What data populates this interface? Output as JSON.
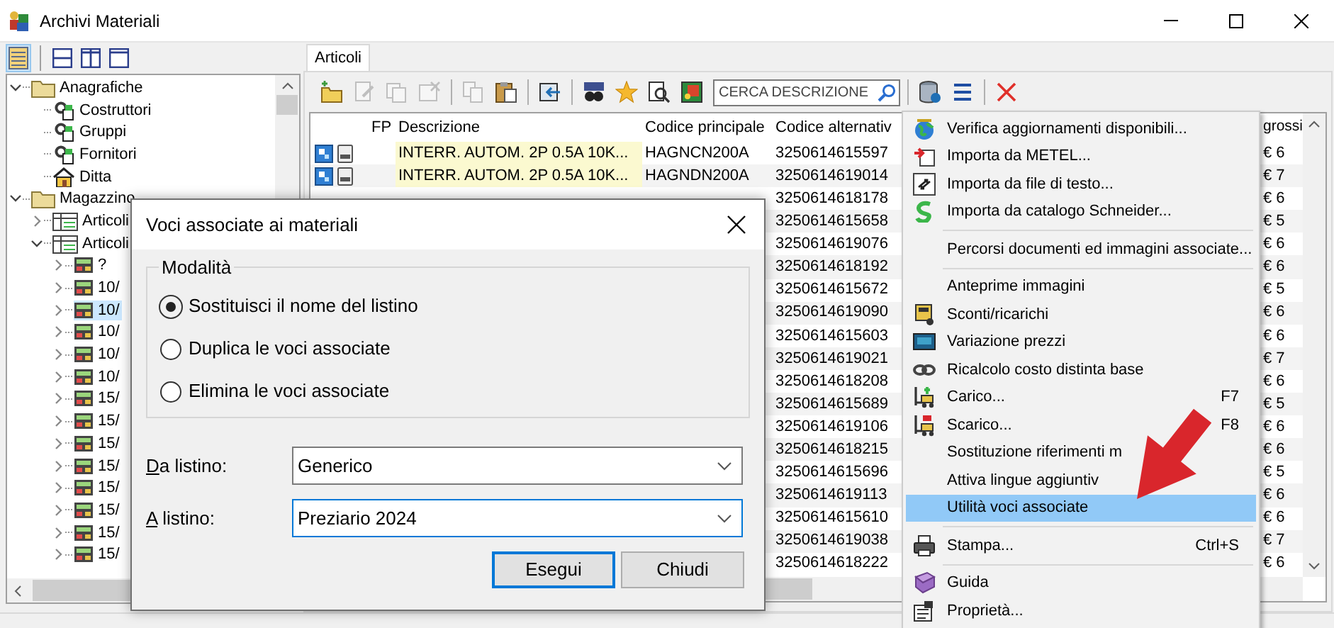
{
  "window": {
    "title": "Archivi Materiali"
  },
  "left_toolbar": [
    {
      "selected": true
    },
    {
      "selected": false
    },
    {
      "selected": false
    },
    {
      "selected": false
    }
  ],
  "tree": [
    {
      "label": "Anagrafiche",
      "kind": "folder",
      "expanded": true,
      "selected": false,
      "children": [
        {
          "label": "Costruttori",
          "kind": "entity",
          "selected": false
        },
        {
          "label": "Gruppi",
          "kind": "entity",
          "selected": false
        },
        {
          "label": "Fornitori",
          "kind": "entity",
          "selected": false
        },
        {
          "label": "Ditta",
          "kind": "company",
          "selected": false
        }
      ]
    },
    {
      "label": "Magazzino",
      "kind": "folder",
      "expanded": true,
      "selected": false,
      "children": [
        {
          "label": "Articoli",
          "kind": "catalog",
          "expanded": false,
          "selected": false
        },
        {
          "label": "Articoli",
          "kind": "catalog",
          "expanded": true,
          "selected": false,
          "children": [
            {
              "label": "?",
              "kind": "record",
              "expanded": false,
              "selected": false
            },
            {
              "label": "10/",
              "kind": "record",
              "expanded": false,
              "selected": false
            },
            {
              "label": "10/",
              "kind": "record",
              "expanded": false,
              "selected": true
            },
            {
              "label": "10/",
              "kind": "record",
              "expanded": false,
              "selected": false
            },
            {
              "label": "10/",
              "kind": "record",
              "expanded": false,
              "selected": false
            },
            {
              "label": "10/",
              "kind": "record",
              "expanded": false,
              "selected": false
            },
            {
              "label": "15/",
              "kind": "record",
              "expanded": false,
              "selected": false
            },
            {
              "label": "15/",
              "kind": "record",
              "expanded": false,
              "selected": false
            },
            {
              "label": "15/",
              "kind": "record",
              "expanded": false,
              "selected": false
            },
            {
              "label": "15/",
              "kind": "record",
              "expanded": false,
              "selected": false
            },
            {
              "label": "15/",
              "kind": "record",
              "expanded": false,
              "selected": false
            },
            {
              "label": "15/",
              "kind": "record",
              "expanded": false,
              "selected": false
            },
            {
              "label": "15/",
              "kind": "record",
              "expanded": false,
              "selected": false
            },
            {
              "label": "15/",
              "kind": "record",
              "expanded": false,
              "selected": false
            }
          ]
        }
      ]
    }
  ],
  "tabs": [
    {
      "label": "Articoli",
      "selected": true
    }
  ],
  "toolbar": [
    {
      "kind": "button",
      "disabled": false
    },
    {
      "kind": "button",
      "disabled": true
    },
    {
      "kind": "button",
      "disabled": true
    },
    {
      "kind": "button",
      "disabled": true
    },
    {
      "kind": "separator"
    },
    {
      "kind": "button",
      "disabled": true
    },
    {
      "kind": "button",
      "disabled": false
    },
    {
      "kind": "separator"
    },
    {
      "kind": "button",
      "disabled": false
    },
    {
      "kind": "separator"
    },
    {
      "kind": "button",
      "disabled": false
    },
    {
      "kind": "button",
      "disabled": false
    },
    {
      "kind": "button",
      "disabled": false
    },
    {
      "kind": "button",
      "disabled": false
    },
    {
      "kind": "search",
      "placeholder": "CERCA DESCRIZIONE"
    },
    {
      "kind": "separator"
    },
    {
      "kind": "button",
      "disabled": false
    },
    {
      "kind": "button",
      "disabled": false
    },
    {
      "kind": "separator"
    },
    {
      "kind": "button",
      "disabled": false
    }
  ],
  "table": {
    "columns": [
      "FP",
      "Descrizione",
      "Codice principale",
      "Codice alternativ",
      "grossi"
    ],
    "rows": [
      {
        "description": "INTERR. AUTOM. 2P 0.5A 10K...",
        "code": "HAGNCN200A",
        "alt_code": "3250614615597",
        "price": "€ 6"
      },
      {
        "description": "INTERR. AUTOM. 2P 0.5A 10K...",
        "code": "HAGNDN200A",
        "alt_code": "3250614619014",
        "price": "€ 7"
      },
      {
        "alt_code": "3250614618178",
        "price": "€ 6"
      },
      {
        "alt_code": "3250614615658",
        "price": "€ 5"
      },
      {
        "alt_code": "3250614619076",
        "price": "€ 6"
      },
      {
        "alt_code": "3250614618192",
        "price": "€ 6"
      },
      {
        "alt_code": "3250614615672",
        "price": "€ 5"
      },
      {
        "alt_code": "3250614619090",
        "price": "€ 6"
      },
      {
        "alt_code": "3250614615603",
        "price": "€ 6"
      },
      {
        "alt_code": "3250614619021",
        "price": "€ 7"
      },
      {
        "alt_code": "3250614618208",
        "price": "€ 6"
      },
      {
        "alt_code": "3250614615689",
        "price": "€ 5"
      },
      {
        "alt_code": "3250614619106",
        "price": "€ 6"
      },
      {
        "alt_code": "3250614618215",
        "price": "€ 6"
      },
      {
        "alt_code": "3250614615696",
        "price": "€ 5"
      },
      {
        "alt_code": "3250614619113",
        "price": "€ 6"
      },
      {
        "alt_code": "3250614615610",
        "price": "€ 6"
      },
      {
        "alt_code": "3250614619038",
        "price": "€ 7"
      },
      {
        "alt_code": "3250614618222",
        "price": "€ 6"
      }
    ]
  },
  "menu": [
    {
      "kind": "item",
      "label": "Verifica aggiornamenti disponibili...",
      "selected": false
    },
    {
      "kind": "item",
      "label": "Importa da METEL...",
      "selected": false
    },
    {
      "kind": "item",
      "label": "Importa da file di testo...",
      "selected": false
    },
    {
      "kind": "item",
      "label": "Importa da catalogo Schneider...",
      "selected": false
    },
    {
      "kind": "separator"
    },
    {
      "kind": "item",
      "label": "Percorsi documenti ed immagini associate...",
      "selected": false
    },
    {
      "kind": "separator"
    },
    {
      "kind": "item",
      "label": "Anteprime immagini",
      "selected": false
    },
    {
      "kind": "item",
      "label": "Sconti/ricarichi",
      "selected": false
    },
    {
      "kind": "item",
      "label": "Variazione prezzi",
      "selected": false
    },
    {
      "kind": "item",
      "label": "Ricalcolo costo distinta base",
      "selected": false
    },
    {
      "kind": "item",
      "label": "Carico...",
      "shortcut": "F7",
      "selected": false
    },
    {
      "kind": "item",
      "label": "Scarico...",
      "shortcut": "F8",
      "selected": false
    },
    {
      "kind": "item",
      "label": "Sostituzione riferimenti m",
      "selected": false
    },
    {
      "kind": "item",
      "label": "Attiva lingue aggiuntiv",
      "selected": false
    },
    {
      "kind": "item",
      "label": "Utilità voci associate",
      "selected": true
    },
    {
      "kind": "separator"
    },
    {
      "kind": "item",
      "label": "Stampa...",
      "shortcut": "Ctrl+S",
      "selected": false
    },
    {
      "kind": "separator"
    },
    {
      "kind": "item",
      "label": "Guida",
      "selected": false
    },
    {
      "kind": "item",
      "label": "Proprietà...",
      "selected": false
    }
  ],
  "dialog": {
    "title": "Voci associate ai materiali",
    "group_label": "Modalità",
    "options": [
      {
        "label": "Sostituisci il nome del listino",
        "selected": true
      },
      {
        "label": "Duplica le voci associate",
        "selected": false
      },
      {
        "label": "Elimina le voci associate",
        "selected": false
      }
    ],
    "fields": [
      {
        "label": "Da listino:",
        "value": "Generico",
        "focused": false
      },
      {
        "label": "A listino:",
        "value": "Preziario 2024",
        "focused": true
      }
    ],
    "buttons": [
      {
        "label": "Esegui",
        "default": true
      },
      {
        "label": "Chiudi",
        "default": false
      }
    ]
  }
}
